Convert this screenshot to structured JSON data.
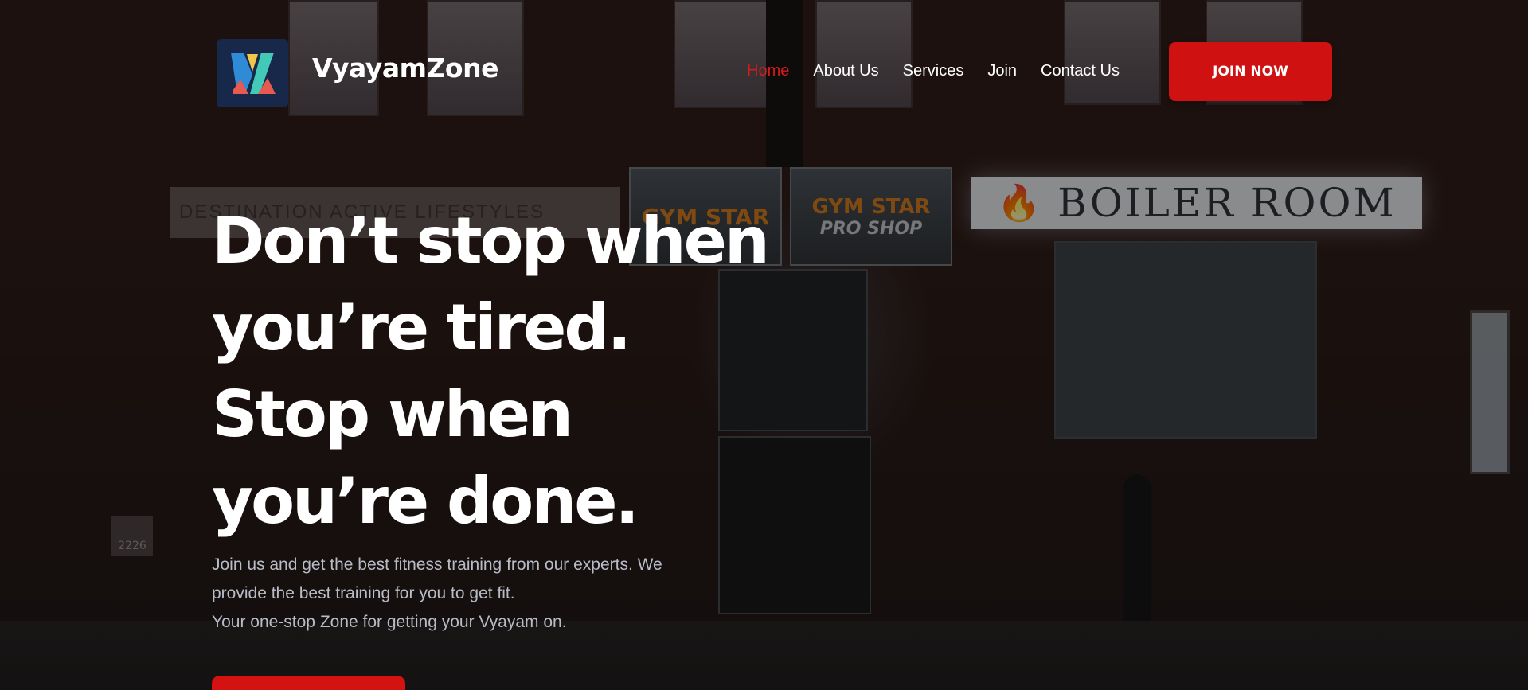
{
  "brand": {
    "name": "VyayamZone",
    "logo_icon": "vyayamzone-logo-icon",
    "logo_bg": "#18284a"
  },
  "nav": {
    "items": [
      {
        "label": "Home",
        "active": true
      },
      {
        "label": "About Us",
        "active": false
      },
      {
        "label": "Services",
        "active": false
      },
      {
        "label": "Join",
        "active": false
      },
      {
        "label": "Contact Us",
        "active": false
      }
    ],
    "cta_label": "JOIN NOW"
  },
  "hero": {
    "headline_lines": [
      "Don’t stop when",
      "you’re tired.",
      "Stop when",
      "you’re done."
    ],
    "subtext_lines": [
      "Join us and get the best fitness training from our experts. We",
      "provide the best training for you to get fit.",
      "Your one-stop Zone for getting your Vyayam on."
    ],
    "background_signs": {
      "boiler_room": "BOILER ROOM",
      "gym_star_1": "GYM STAR",
      "gym_star_2": "GYM STAR",
      "pro_shop": "PRO SHOP",
      "destination": "DESTINATION ACTIVE LIFESTYLES",
      "building_number": "2226"
    }
  },
  "colors": {
    "accent": "#d51212",
    "active_nav": "#d51b1b",
    "headline": "#ffffff",
    "subtext": "#b8bcc6"
  }
}
